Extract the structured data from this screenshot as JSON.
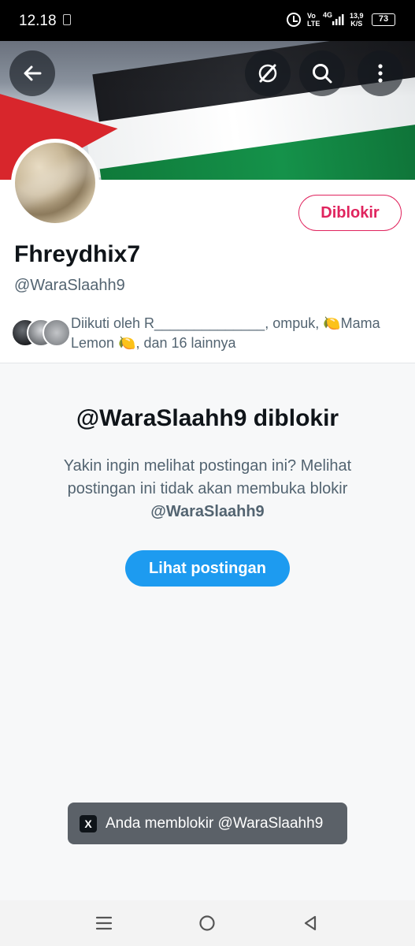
{
  "status_bar": {
    "time": "12.18",
    "network_top": "Vo",
    "network_bottom": "LTE",
    "gen": "4G",
    "speed_top": "13,9",
    "speed_bottom": "K/S",
    "battery": "73"
  },
  "header": {
    "icons": [
      "back-arrow-icon",
      "grok-icon",
      "search-icon",
      "more-vertical-icon"
    ]
  },
  "profile": {
    "blocked_button_label": "Diblokir",
    "display_name": "Fhreydhix7",
    "handle": "@WaraSlaahh9",
    "followed_by_text": "Diikuti oleh R______________, ompuk, 🍋Mama Lemon 🍋, dan 16 lainnya"
  },
  "blocked_notice": {
    "title": "@WaraSlaahh9 diblokir",
    "description": "Yakin ingin melihat postingan ini? Melihat postingan ini tidak akan membuka blokir",
    "description_handle": "@WaraSlaahh9",
    "view_button_label": "Lihat postingan"
  },
  "toast": {
    "logo": "X",
    "message": "Anda memblokir @WaraSlaahh9"
  },
  "colors": {
    "blocked_red": "#e0245e",
    "accent_blue": "#1d9bf0",
    "secondary_text": "#536471"
  }
}
